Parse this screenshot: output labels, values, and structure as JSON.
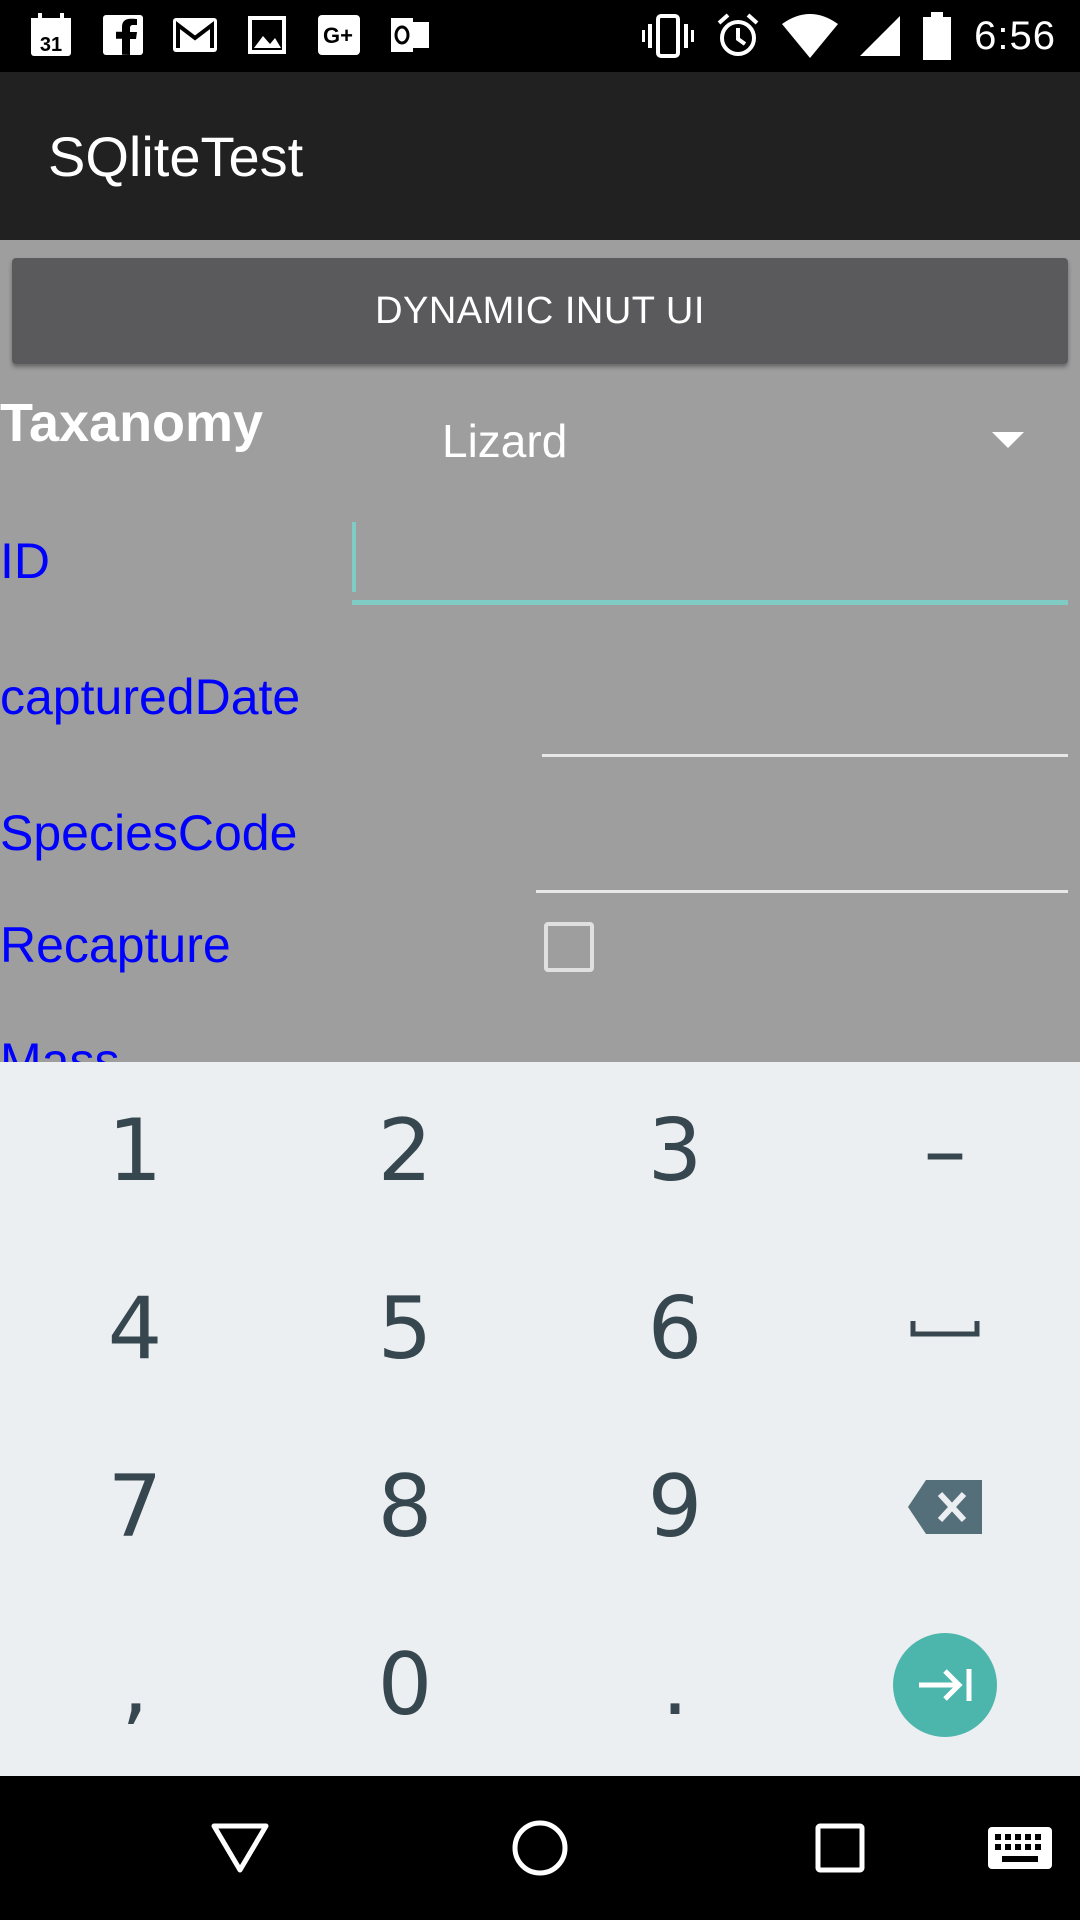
{
  "status_bar": {
    "time": "6:56",
    "calendar_day": "31",
    "left_icons": [
      "calendar-icon",
      "facebook-icon",
      "gmail-icon",
      "gallery-icon",
      "google-plus-icon",
      "outlook-icon"
    ],
    "right_icons": [
      "vibrate-icon",
      "alarm-icon",
      "wifi-icon",
      "signal-icon",
      "battery-icon"
    ]
  },
  "app": {
    "title": "SQliteTest"
  },
  "form": {
    "dynamic_button_label": "DYNAMIC INUT UI",
    "taxonomy_label": "Taxanomy",
    "taxonomy_value": "Lizard",
    "id_label": "ID",
    "id_value": "",
    "captured_date_label": "capturedDate",
    "species_code_label": "SpeciesCode",
    "recapture_label": "Recapture",
    "recapture_checked": false,
    "mass_label": "Mass"
  },
  "keyboard": {
    "keys": [
      "1",
      "2",
      "3",
      "–",
      "4",
      "5",
      "6",
      "␣",
      "7",
      "8",
      "9",
      "⌫",
      ",",
      "0",
      ".",
      "→|"
    ]
  },
  "colors": {
    "label_blue": "#0000ff",
    "accent_teal": "#80cbc4",
    "enter_teal": "#4db6ac",
    "content_bg": "#9e9e9e",
    "keyboard_bg": "#eceff1"
  }
}
